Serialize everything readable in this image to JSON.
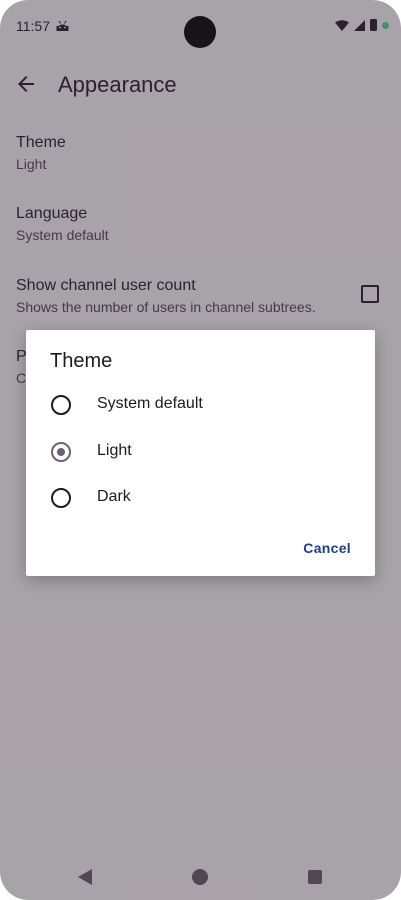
{
  "status_bar": {
    "time": "11:57"
  },
  "app_bar": {
    "title": "Appearance"
  },
  "preferences": [
    {
      "title": "Theme",
      "summary": "Light"
    },
    {
      "title": "Language",
      "summary": "System default"
    },
    {
      "title": "Show channel user count",
      "summary": "Shows the number of users in channel subtrees.",
      "checked": false
    },
    {
      "title": "P",
      "summary": "C"
    }
  ],
  "dialog": {
    "title": "Theme",
    "options": [
      {
        "label": "System default",
        "selected": false
      },
      {
        "label": "Light",
        "selected": true
      },
      {
        "label": "Dark",
        "selected": false
      }
    ],
    "cancel_label": "Cancel"
  },
  "colors": {
    "accent": "#6e6177",
    "button_text": "#1a3f8c",
    "scrim": "#3c2d3e"
  }
}
